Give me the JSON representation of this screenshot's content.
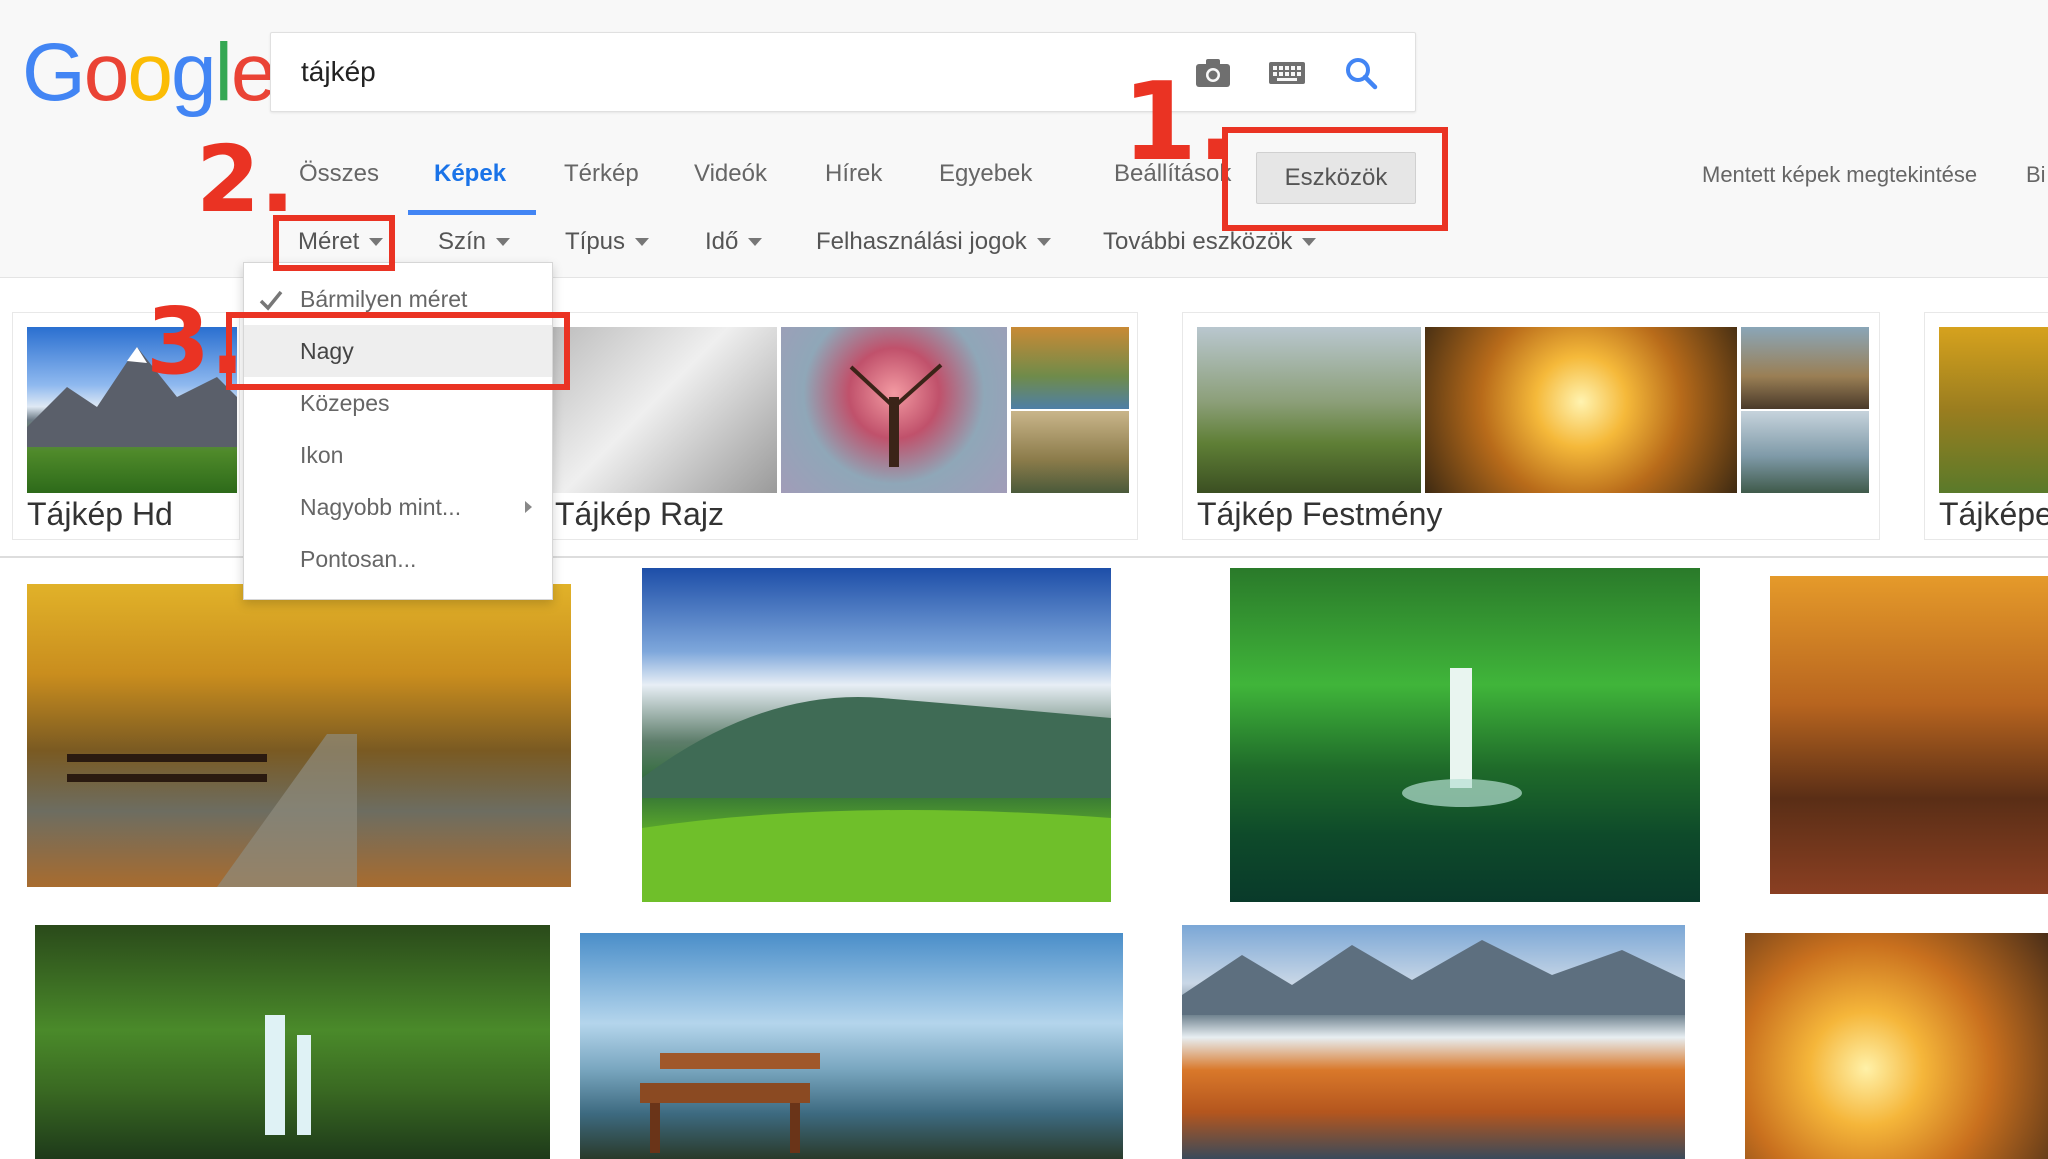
{
  "logo": {
    "letters": [
      "G",
      "o",
      "o",
      "g",
      "l",
      "e"
    ],
    "colors": [
      "#4285F4",
      "#EA4335",
      "#FBBC05",
      "#4285F4",
      "#34A853",
      "#EA4335"
    ]
  },
  "search": {
    "value": "tájkép",
    "camera_icon": "camera-icon",
    "keyboard_icon": "keyboard-icon",
    "search_icon": "search-icon"
  },
  "tabs": [
    "Összes",
    "Képek",
    "Térkép",
    "Videók",
    "Hírek",
    "Egyebek",
    "Beállítások"
  ],
  "tools_button": "Eszközök",
  "right_links": {
    "saved": "Mentett képek megtekintése",
    "cut": "Bi"
  },
  "filters": [
    "Méret",
    "Szín",
    "Típus",
    "Idő",
    "Felhasználási jogok",
    "További eszközök"
  ],
  "dropdown": {
    "items": [
      "Bármilyen méret",
      "Nagy",
      "Közepes",
      "Ikon",
      "Nagyobb mint...",
      "Pontosan..."
    ]
  },
  "related": [
    "Tájkép Hd",
    "Tájkép Rajz",
    "Tájkép Festmény",
    "Tájképe"
  ],
  "annotations": [
    "1.",
    "2.",
    "3."
  ],
  "colors": {
    "accent": "#4285f4",
    "annotation": "#ea3323"
  }
}
